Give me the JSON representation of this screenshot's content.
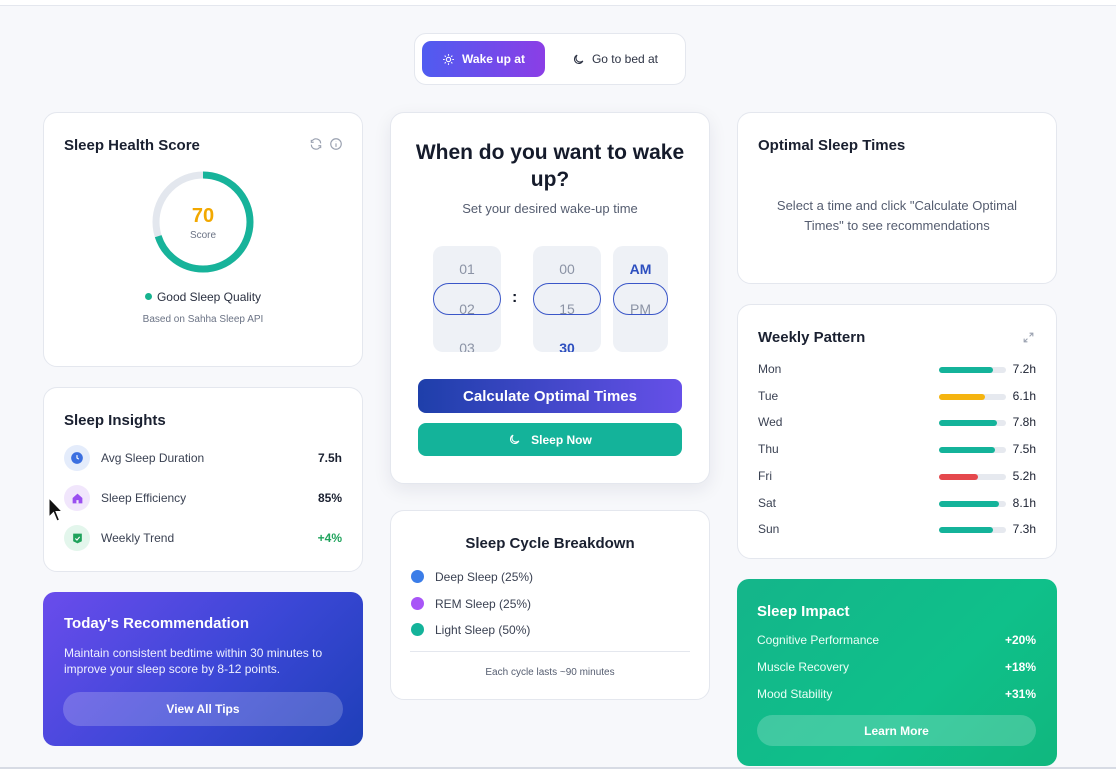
{
  "mode_toggle": {
    "wake_label": "Wake up at",
    "bed_label": "Go to bed at",
    "active": "wake"
  },
  "health_score": {
    "title": "Sleep Health Score",
    "score": "70",
    "score_fraction": 0.7,
    "score_label": "Score",
    "quality": "Good Sleep Quality",
    "source": "Based on Sahha Sleep API",
    "ring_color": "#17b39a",
    "score_color": "#f2a800"
  },
  "insights": {
    "title": "Sleep Insights",
    "items": [
      {
        "icon": "clock-icon",
        "label": "Avg Sleep Duration",
        "value": "7.5h"
      },
      {
        "icon": "home-icon",
        "label": "Sleep Efficiency",
        "value": "85%"
      },
      {
        "icon": "trend-icon",
        "label": "Weekly Trend",
        "value": "+4%"
      }
    ]
  },
  "recommendation": {
    "title": "Today's Recommendation",
    "text": "Maintain consistent bedtime within 30 minutes to improve your sleep score by 8-12 points.",
    "button": "View All Tips"
  },
  "wake_card": {
    "title": "When do you want to wake up?",
    "subtitle": "Set your desired wake-up time",
    "hours": [
      "01",
      "02",
      "03"
    ],
    "minutes": [
      "00",
      "15",
      "30"
    ],
    "periods": [
      "AM",
      "PM"
    ],
    "separator": ":",
    "calc_button": "Calculate Optimal Times",
    "sleep_button": "Sleep Now"
  },
  "cycle": {
    "title": "Sleep Cycle Breakdown",
    "items": [
      {
        "label": "Deep Sleep (25%)",
        "color": "#3b7de8"
      },
      {
        "label": "REM Sleep (25%)",
        "color": "#a855f7"
      },
      {
        "label": "Light Sleep (50%)",
        "color": "#14b39a"
      }
    ],
    "note": "Each cycle lasts ~90 minutes"
  },
  "optimal": {
    "title": "Optimal Sleep Times",
    "text": "Select a time and click \"Calculate Optimal Times\" to see recommendations"
  },
  "weekly": {
    "title": "Weekly Pattern",
    "days": [
      {
        "day": "Mon",
        "hours": 7.2,
        "label": "7.2h",
        "fill": 0.8,
        "color": "#14b39a"
      },
      {
        "day": "Tue",
        "hours": 6.1,
        "label": "6.1h",
        "fill": 0.68,
        "color": "#f5b40f"
      },
      {
        "day": "Wed",
        "hours": 7.8,
        "label": "7.8h",
        "fill": 0.87,
        "color": "#14b39a"
      },
      {
        "day": "Thu",
        "hours": 7.5,
        "label": "7.5h",
        "fill": 0.83,
        "color": "#14b39a"
      },
      {
        "day": "Fri",
        "hours": 5.2,
        "label": "5.2h",
        "fill": 0.58,
        "color": "#e5484d"
      },
      {
        "day": "Sat",
        "hours": 8.1,
        "label": "8.1h",
        "fill": 0.9,
        "color": "#14b39a"
      },
      {
        "day": "Sun",
        "hours": 7.3,
        "label": "7.3h",
        "fill": 0.81,
        "color": "#14b39a"
      }
    ]
  },
  "impact": {
    "title": "Sleep Impact",
    "items": [
      {
        "label": "Cognitive Performance",
        "value": "+20%"
      },
      {
        "label": "Muscle Recovery",
        "value": "+18%"
      },
      {
        "label": "Mood Stability",
        "value": "+31%"
      }
    ],
    "button": "Learn More"
  }
}
